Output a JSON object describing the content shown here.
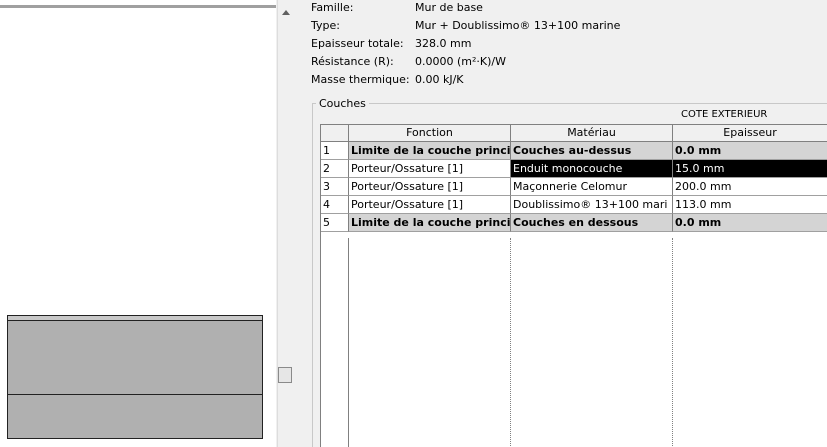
{
  "properties": {
    "famille": {
      "label": "Famille:",
      "value": "Mur de base"
    },
    "type": {
      "label": "Type:",
      "value": "Mur + Doublissimo® 13+100 marine"
    },
    "epaisseur": {
      "label": "Epaisseur totale:",
      "value": "328.0 mm"
    },
    "resistance": {
      "label": "Résistance (R):",
      "value": "0.0000 (m²·K)/W"
    },
    "masse": {
      "label": "Masse thermique:",
      "value": "0.00 kJ/K"
    }
  },
  "couches": {
    "group_label": "Couches",
    "side_label": "COTE EXTERIEUR",
    "columns": [
      "Fonction",
      "Matériau",
      "Epaisseur"
    ],
    "rows": [
      {
        "num": "1",
        "fonction": "Limite de la couche principal",
        "materiau": "Couches au-dessus",
        "epaisseur": "0.0 mm"
      },
      {
        "num": "2",
        "fonction": "Porteur/Ossature [1]",
        "materiau": "Enduit monocouche",
        "epaisseur": "15.0 mm"
      },
      {
        "num": "3",
        "fonction": "Porteur/Ossature [1]",
        "materiau": "Maçonnerie Celomur",
        "epaisseur": "200.0 mm"
      },
      {
        "num": "4",
        "fonction": "Porteur/Ossature [1]",
        "materiau": "Doublissimo® 13+100 mari",
        "epaisseur": "113.0 mm"
      },
      {
        "num": "5",
        "fonction": "Limite de la couche principal",
        "materiau": "Couches en dessous",
        "epaisseur": "0.0 mm"
      }
    ]
  }
}
